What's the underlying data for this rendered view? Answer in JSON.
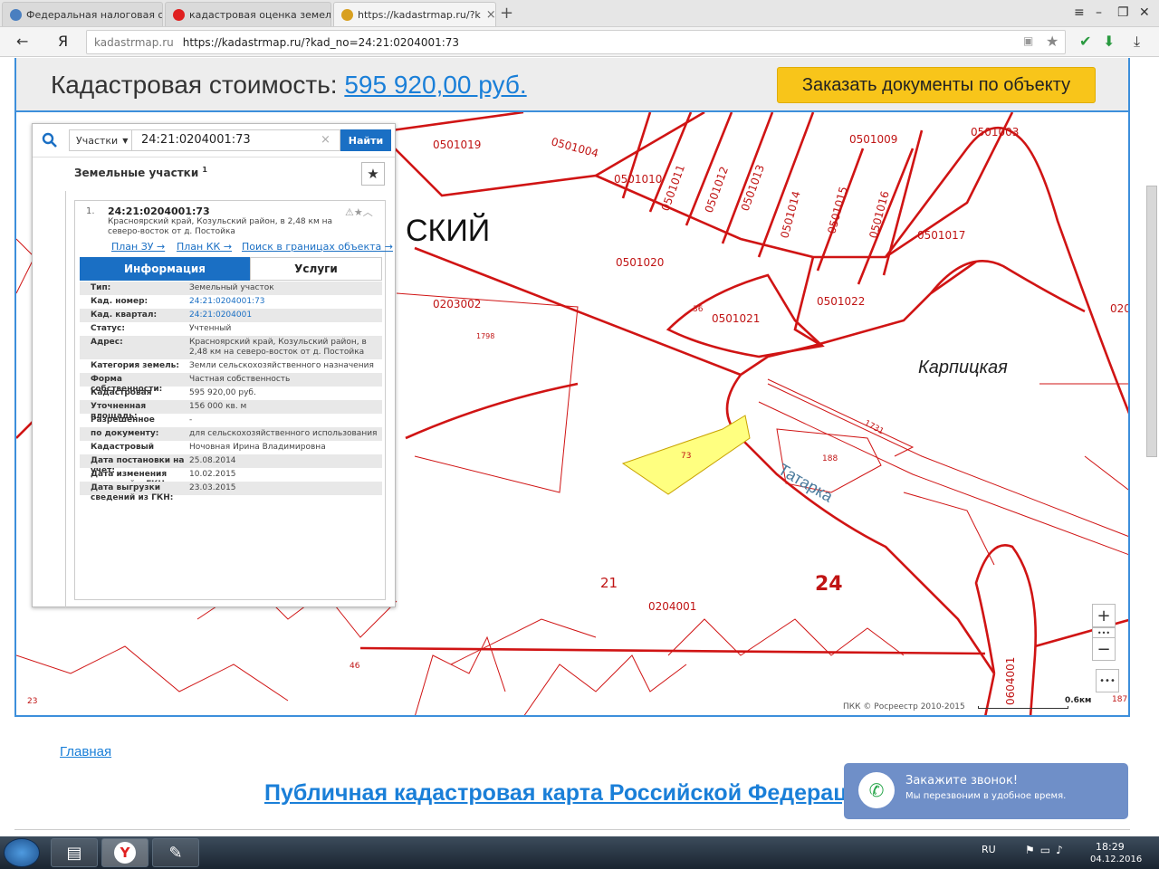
{
  "browser": {
    "tabs": [
      {
        "label": "Федеральная налоговая сл",
        "color": "#4a7fc0"
      },
      {
        "label": "кадастровая оценка земел",
        "color": "#e02020"
      },
      {
        "label": "https://kadastrmap.ru/?k",
        "color": "#d8a020"
      }
    ],
    "new_tab": "+",
    "address_host": "kadastrmap.ru",
    "address_url": "https://kadastrmap.ru/?kad_no=24:21:0204001:73"
  },
  "header": {
    "price_label": "Кадастровая стоимость: ",
    "price_value": "595 920,00 руб.",
    "order_button": "Заказать документы по объекту"
  },
  "panel": {
    "type_select": "Участки",
    "query": "24:21:0204001:73",
    "find_button": "Найти",
    "list_title": "Земельные участки",
    "list_count": "1",
    "card": {
      "num": "1.",
      "title": "24:21:0204001:73",
      "address": "Красноярский край, Козульский район, в 2,48 км на северо-восток от д. Постойка",
      "link_zu": "План ЗУ →",
      "link_kk": "План КК →",
      "link_search": "Поиск в границах объекта →",
      "tab_info": "Информация",
      "tab_services": "Услуги",
      "rows": [
        {
          "k": "Тип:",
          "v": "Земельный участок"
        },
        {
          "k": "Кад. номер:",
          "v": "24:21:0204001:73"
        },
        {
          "k": "Кад. квартал:",
          "v": "24:21:0204001"
        },
        {
          "k": "Статус:",
          "v": "Учтенный"
        },
        {
          "k": "Адрес:",
          "v": "Красноярский край, Козульский район, в 2,48 км на северо-восток от д. Постойка"
        },
        {
          "k": "Категория земель:",
          "v": "Земли сельскохозяйственного назначения"
        },
        {
          "k": "Форма собственности:",
          "v": "Частная собственность"
        },
        {
          "k": "Кадастровая стоимость:",
          "v": "595 920,00 руб."
        },
        {
          "k": "Уточненная площадь:",
          "v": "156 000 кв. м"
        },
        {
          "k": "Разрешенное использование:",
          "v": "-"
        },
        {
          "k": "по документу:",
          "v": "для сельскохозяйственного использования"
        },
        {
          "k": "Кадастровый инженер:",
          "v": "Ночовная Ирина Владимировна"
        },
        {
          "k": "Дата постановки на учет:",
          "v": "25.08.2014"
        },
        {
          "k": "Дата изменения сведений в ГКН:",
          "v": "10.02.2015"
        },
        {
          "k": "Дата выгрузки сведений из ГКН:",
          "v": "23.03.2015"
        }
      ]
    }
  },
  "map": {
    "labels": [
      "0501019",
      "0501004",
      "0501010",
      "0501011",
      "0501012",
      "0501013",
      "0501014",
      "0501015",
      "0501016",
      "0501009",
      "0501003",
      "0501017",
      "0501020",
      "0501021",
      "0501022",
      "0203002",
      "1798",
      "36",
      "73",
      "1731",
      "188",
      "21",
      "0204001",
      "24",
      "46",
      "23",
      "187",
      "0604001",
      "020"
    ],
    "place_name": "Карпицкая",
    "river_name": "Татарка",
    "village_fragment": "СКИЙ",
    "attribution": "ПКК © Росреестр 2010-2015",
    "scale": "0.6км",
    "zoom_in": "+",
    "zoom_out": "−",
    "more": "•••",
    "parcel_color": "#ffff80",
    "line_color": "#d01414"
  },
  "footer": {
    "home_link": "Главная",
    "big_title": "Публичная кадастровая карта Российской Федерации"
  },
  "callback": {
    "title": "Закажите звонок!",
    "subtitle": "Мы перезвоним в удобное время."
  },
  "taskbar": {
    "lang": "RU",
    "time": "18:29",
    "date": "04.12.2016"
  }
}
